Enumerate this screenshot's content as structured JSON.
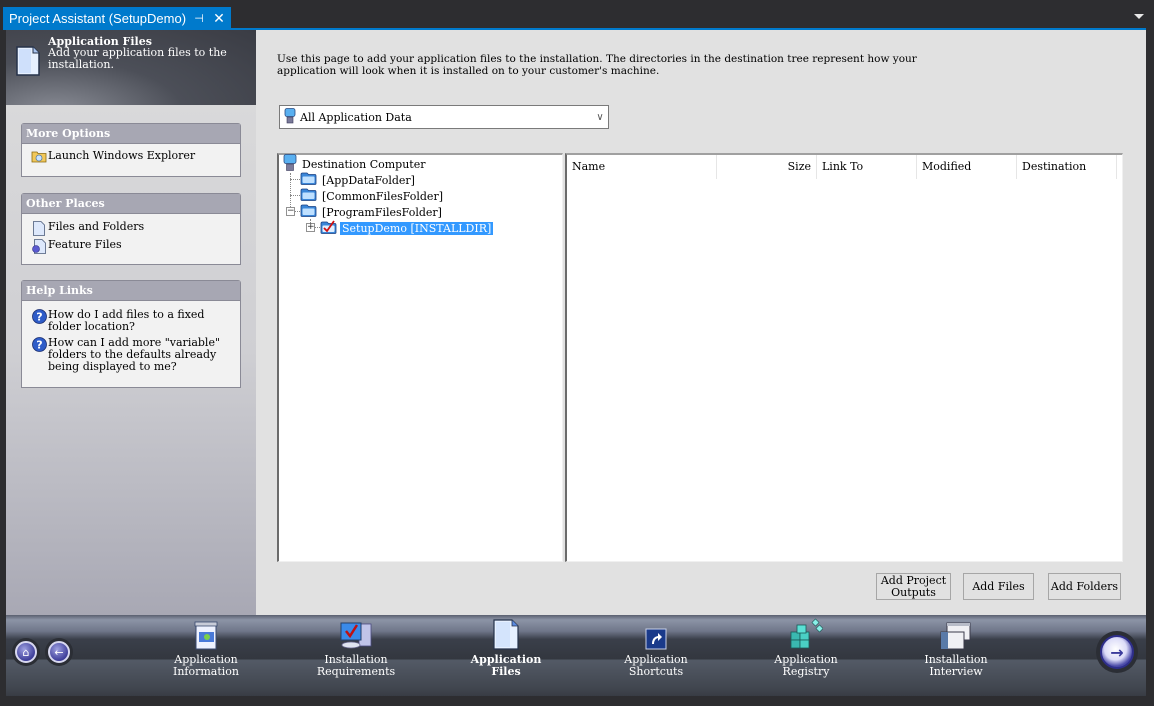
{
  "tab": {
    "title": "Project Assistant (SetupDemo)",
    "pin_glyph": "⊣",
    "close_glyph": "✕"
  },
  "header": {
    "title": "Application Files",
    "description": "Add your application files to the installation."
  },
  "more_options": {
    "title": "More Options",
    "items": [
      {
        "label": "Launch Windows Explorer",
        "icon": "folder-search-icon"
      }
    ]
  },
  "other_places": {
    "title": "Other Places",
    "items": [
      {
        "label": "Files and Folders",
        "icon": "file-icon"
      },
      {
        "label": "Feature Files",
        "icon": "feature-file-icon"
      }
    ]
  },
  "help_links": {
    "title": "Help Links",
    "items": [
      {
        "label": "How do I add files to a fixed folder location?",
        "icon": "help-icon"
      },
      {
        "label": "How can I add more \"variable\" folders to the defaults already being displayed to me?",
        "icon": "help-icon"
      }
    ]
  },
  "content": {
    "intro": "Use this page to add your application files to the installation. The directories in the destination tree represent how your application will look when it is installed on to your customer's machine.",
    "data_select": {
      "value": "All Application Data"
    },
    "tree": {
      "root": "Destination Computer",
      "nodes": [
        {
          "label": "[AppDataFolder]"
        },
        {
          "label": "[CommonFilesFolder]"
        },
        {
          "label": "[ProgramFilesFolder]",
          "expanded": true
        },
        {
          "label": "SetupDemo [INSTALLDIR]",
          "selected": true,
          "collapsed": true
        }
      ]
    },
    "file_list": {
      "columns": [
        "Name",
        "Size",
        "Link To",
        "Modified",
        "Destination"
      ],
      "rows": []
    },
    "buttons": {
      "add_project_outputs": "Add Project\nOutputs",
      "add_files": "Add Files",
      "add_folders": "Add Folders"
    }
  },
  "nav": {
    "home_glyph": "⌂",
    "back_glyph": "←",
    "next_glyph": "→",
    "steps": [
      {
        "label": "Application\nInformation",
        "active": false
      },
      {
        "label": "Installation\nRequirements",
        "active": false
      },
      {
        "label": "Application\nFiles",
        "active": true
      },
      {
        "label": "Application\nShortcuts",
        "active": false
      },
      {
        "label": "Application\nRegistry",
        "active": false
      },
      {
        "label": "Installation\nInterview",
        "active": false
      }
    ]
  }
}
